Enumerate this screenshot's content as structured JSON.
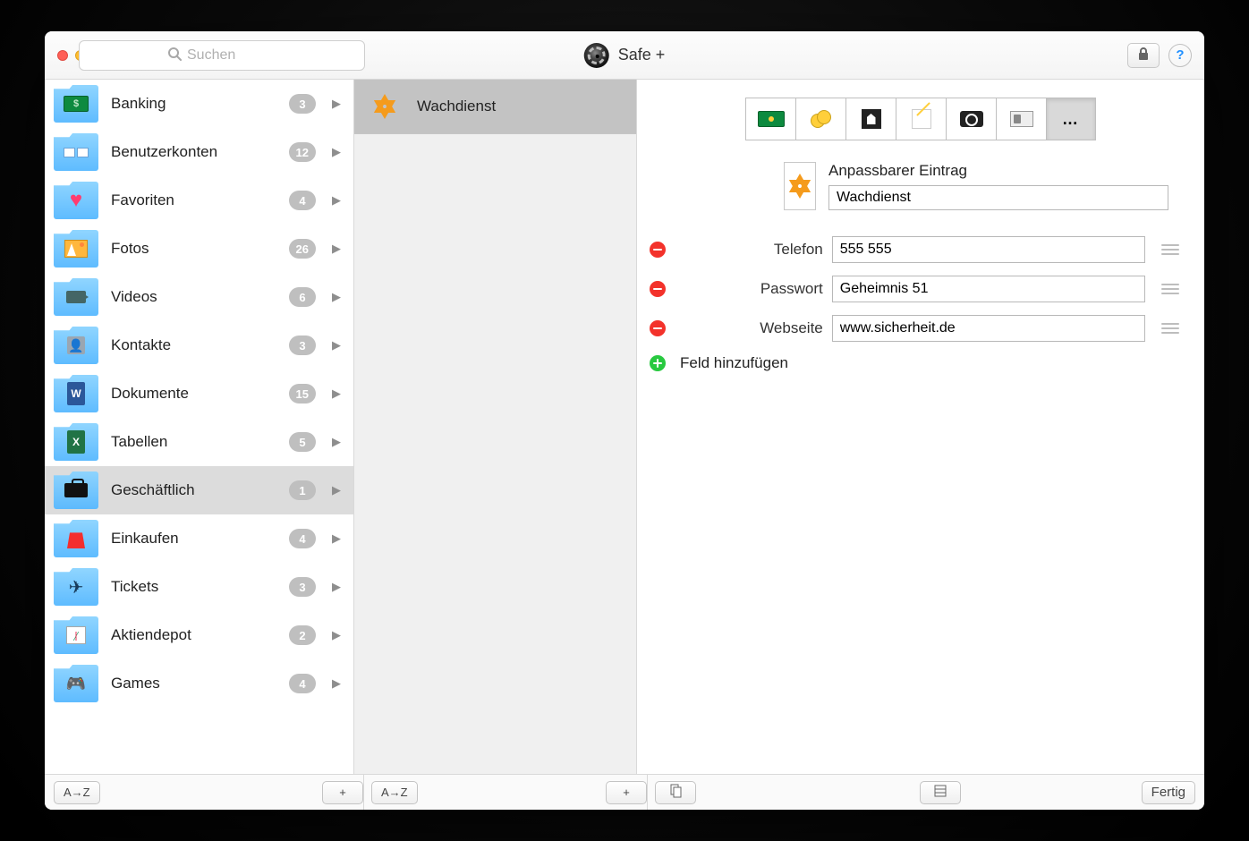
{
  "app": {
    "title": "Safe +"
  },
  "search": {
    "placeholder": "Suchen"
  },
  "sidebar": {
    "items": [
      {
        "label": "Banking",
        "count": "3",
        "icon": "banking"
      },
      {
        "label": "Benutzerkonten",
        "count": "12",
        "icon": "accounts"
      },
      {
        "label": "Favoriten",
        "count": "4",
        "icon": "heart"
      },
      {
        "label": "Fotos",
        "count": "26",
        "icon": "photos"
      },
      {
        "label": "Videos",
        "count": "6",
        "icon": "video"
      },
      {
        "label": "Kontakte",
        "count": "3",
        "icon": "contact"
      },
      {
        "label": "Dokumente",
        "count": "15",
        "icon": "word"
      },
      {
        "label": "Tabellen",
        "count": "5",
        "icon": "excel"
      },
      {
        "label": "Geschäftlich",
        "count": "1",
        "icon": "briefcase",
        "selected": true
      },
      {
        "label": "Einkaufen",
        "count": "4",
        "icon": "bag"
      },
      {
        "label": "Tickets",
        "count": "3",
        "icon": "plane"
      },
      {
        "label": "Aktiendepot",
        "count": "2",
        "icon": "stocks"
      },
      {
        "label": "Games",
        "count": "4",
        "icon": "gamepad"
      }
    ]
  },
  "entries": {
    "items": [
      {
        "label": "Wachdienst",
        "selected": true
      }
    ]
  },
  "type_picker": {
    "options": [
      "credit-card",
      "banking-money",
      "people",
      "note",
      "camera",
      "contact-card",
      "more"
    ],
    "selected_index": 6,
    "more_label": "…"
  },
  "detail": {
    "category": "Anpassbarer Eintrag",
    "name": "Wachdienst",
    "fields": [
      {
        "label": "Telefon",
        "value": "555 555"
      },
      {
        "label": "Passwort",
        "value": "Geheimnis 51"
      },
      {
        "label": "Webseite",
        "value": "www.sicherheit.de"
      }
    ],
    "add_field_label": "Feld hinzufügen"
  },
  "bottom": {
    "sort_label": "A→Z",
    "add_label": "+",
    "done_label": "Fertig"
  }
}
